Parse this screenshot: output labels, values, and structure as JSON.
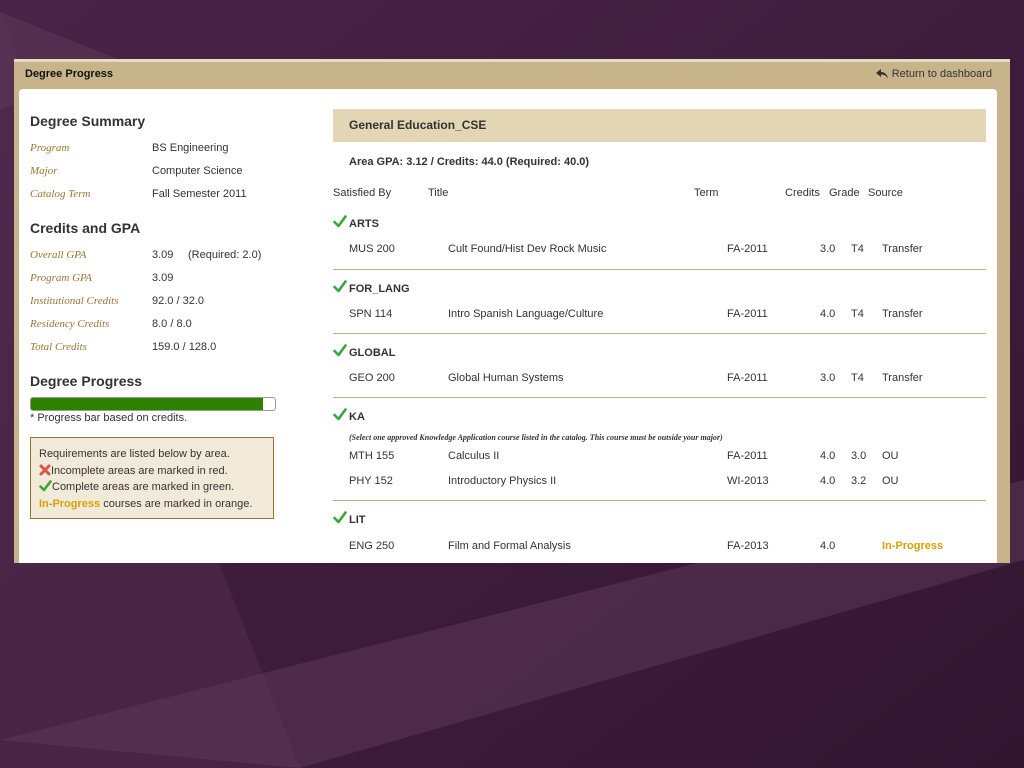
{
  "window": {
    "title": "Degree Progress",
    "return_label": "Return to dashboard"
  },
  "colors": {
    "accent_gold": "#9a7533",
    "complete_green": "#2e8000",
    "in_progress_orange": "#d9a000",
    "incomplete_red": "#d9534f"
  },
  "summary": {
    "heading": "Degree Summary",
    "items": [
      {
        "label": "Program",
        "value": "BS Engineering"
      },
      {
        "label": "Major",
        "value": "Computer Science"
      },
      {
        "label": "Catalog Term",
        "value": "Fall Semester 2011"
      }
    ]
  },
  "credits_gpa": {
    "heading": "Credits and GPA",
    "items": [
      {
        "label": "Overall GPA",
        "value": "3.09",
        "extra": "(Required: 2.0)"
      },
      {
        "label": "Program GPA",
        "value": "3.09"
      },
      {
        "label": "Institutional Credits",
        "value": "92.0 / 32.0"
      },
      {
        "label": "Residency Credits",
        "value": "8.0 / 8.0"
      },
      {
        "label": "Total Credits",
        "value": "159.0 / 128.0"
      }
    ]
  },
  "progress": {
    "heading": "Degree Progress",
    "percent": 95,
    "note": "* Progress bar based on credits."
  },
  "legend": {
    "line1": "Requirements are listed below by area.",
    "incomplete": "Incomplete areas are marked in red.",
    "complete": "Complete areas are marked in green.",
    "in_progress_word": "In-Progress",
    "in_progress_rest": " courses are marked in orange."
  },
  "area": {
    "name": "General Education_CSE",
    "gpa_line": "Area GPA: 3.12 / Credits: 44.0 (Required: 40.0)",
    "columns": {
      "satisfied_by": "Satisfied By",
      "title": "Title",
      "term": "Term",
      "credits": "Credits",
      "grade": "Grade",
      "source": "Source"
    },
    "groups": [
      {
        "name": "ARTS",
        "courses": [
          {
            "code": "MUS 200",
            "title": "Cult Found/Hist Dev Rock Music",
            "term": "FA-2011",
            "credits": "3.0",
            "grade": "T4",
            "source": "Transfer"
          }
        ]
      },
      {
        "name": "FOR_LANG",
        "courses": [
          {
            "code": "SPN 114",
            "title": "Intro Spanish Language/Culture",
            "term": "FA-2011",
            "credits": "4.0",
            "grade": "T4",
            "source": "Transfer"
          }
        ]
      },
      {
        "name": "GLOBAL",
        "courses": [
          {
            "code": "GEO 200",
            "title": "Global Human Systems",
            "term": "FA-2011",
            "credits": "3.0",
            "grade": "T4",
            "source": "Transfer"
          }
        ]
      },
      {
        "name": "KA",
        "note": "(Select one approved Knowledge Application course listed in the catalog. This course must be outside your major)",
        "courses": [
          {
            "code": "MTH 155",
            "title": "Calculus II",
            "term": "FA-2011",
            "credits": "4.0",
            "grade": "3.0",
            "source": "OU"
          },
          {
            "code": "PHY 152",
            "title": "Introductory Physics II",
            "term": "WI-2013",
            "credits": "4.0",
            "grade": "3.2",
            "source": "OU"
          }
        ]
      },
      {
        "name": "LIT",
        "courses": [
          {
            "code": "ENG 250",
            "title": "Film and Formal Analysis",
            "term": "FA-2013",
            "credits": "4.0",
            "grade": "",
            "source": "In-Progress"
          }
        ]
      }
    ]
  }
}
